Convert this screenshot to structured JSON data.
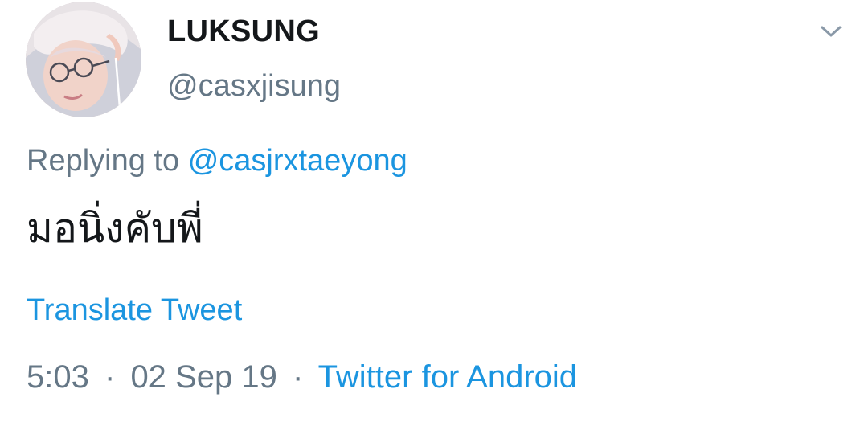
{
  "author": {
    "display_name": "LUKSUNG",
    "handle": "@casxjisung"
  },
  "reply": {
    "prefix": "Replying to",
    "to_handle": "@casjrxtaeyong"
  },
  "tweet": {
    "text": "มอนิ่งคับพี่",
    "translate_label": "Translate Tweet"
  },
  "meta": {
    "time": "5:03",
    "separator": "·",
    "date": "02 Sep 19",
    "source": "Twitter for Android"
  },
  "icons": {
    "menu": "chevron-down-icon"
  },
  "colors": {
    "link": "#1b95e0",
    "secondary": "#657786",
    "primary": "#14171a"
  }
}
